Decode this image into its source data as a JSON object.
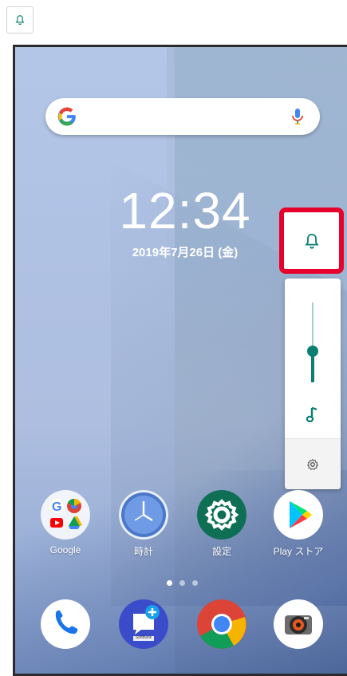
{
  "clock": {
    "time": "12:34",
    "date": "2019年7月26日 (金)"
  },
  "search": {
    "logo_letter": "G"
  },
  "volume": {
    "level": 0.45
  },
  "apps": [
    {
      "label": "Google"
    },
    {
      "label": "時計"
    },
    {
      "label": "設定"
    },
    {
      "label": "Play ストア"
    }
  ],
  "dock": {
    "softbank_text": "SoftBank"
  },
  "colors": {
    "highlight": "#e8002d",
    "accent": "#0b7f74",
    "settings_green": "#0f6f55"
  }
}
